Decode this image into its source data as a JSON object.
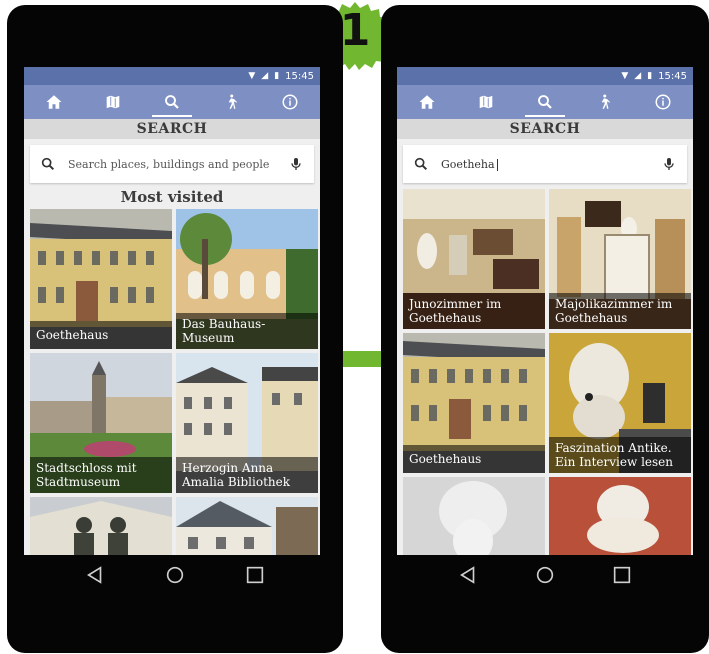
{
  "step_number": "1",
  "status_time": "15:45",
  "colors": {
    "accent": "#7d8fc3",
    "status": "#5b71a9",
    "badge": "#71b730"
  },
  "nav_icons": [
    "home-icon",
    "map-icon",
    "search-icon",
    "walk-icon",
    "info-icon"
  ],
  "left": {
    "section_title": "SEARCH",
    "search": {
      "placeholder": "Search places, buildings and people",
      "value": ""
    },
    "heading": "Most visited",
    "tiles": [
      {
        "label": "Goethehaus"
      },
      {
        "label": "Das Bauhaus-Museum"
      },
      {
        "label": "Stadtschloss mit Stadtmuseum"
      },
      {
        "label": "Herzogin Anna Amalia Bibliothek"
      },
      {
        "label": ""
      },
      {
        "label": ""
      }
    ]
  },
  "right": {
    "section_title": "SEARCH",
    "search": {
      "placeholder": "",
      "value": "Goetheha"
    },
    "tiles": [
      {
        "label": "Junozimmer im Goethehaus"
      },
      {
        "label": "Majolikazimmer im Goethehaus"
      },
      {
        "label": "Goethehaus"
      },
      {
        "label": "Faszination Antike. Ein Interview lesen"
      },
      {
        "label": ""
      },
      {
        "label": ""
      }
    ]
  }
}
